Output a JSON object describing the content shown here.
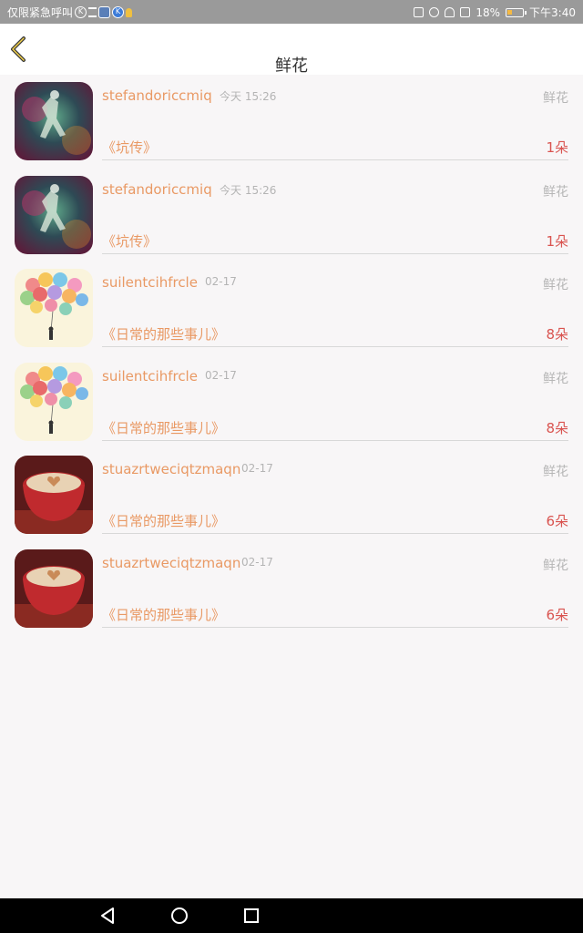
{
  "status_bar": {
    "carrier": "仅限紧急呼叫",
    "battery_percent": "18%",
    "time": "下午3:40"
  },
  "header": {
    "title": "鲜花",
    "back_icon": "chevron-left-icon"
  },
  "items": [
    {
      "name": "stefandoriccmiq",
      "time": "今天 15:26",
      "type": "鲜花",
      "book": "《坑传》",
      "count": "1朵",
      "avatar": "dancer"
    },
    {
      "name": "stefandoriccmiq",
      "time": "今天 15:26",
      "type": "鲜花",
      "book": "《坑传》",
      "count": "1朵",
      "avatar": "dancer"
    },
    {
      "name": "suilentcihfrcle",
      "time": "02-17",
      "type": "鲜花",
      "book": "《日常的那些事儿》",
      "count": "8朵",
      "avatar": "balloons"
    },
    {
      "name": "suilentcihfrcle",
      "time": "02-17",
      "type": "鲜花",
      "book": "《日常的那些事儿》",
      "count": "8朵",
      "avatar": "balloons"
    },
    {
      "name": "stuazrtweciqtzmaqn",
      "time": "02-17",
      "type": "鲜花",
      "book": "《日常的那些事儿》",
      "count": "6朵",
      "avatar": "coffee"
    },
    {
      "name": "stuazrtweciqtzmaqn",
      "time": "02-17",
      "type": "鲜花",
      "book": "《日常的那些事儿》",
      "count": "6朵",
      "avatar": "coffee"
    }
  ],
  "colors": {
    "accent_orange": "#e99964",
    "count_red": "#d9534f",
    "muted_gray": "#b6b6b6"
  },
  "nav_bar": {
    "buttons": [
      "back-triangle-icon",
      "home-circle-icon",
      "recents-square-icon"
    ]
  }
}
